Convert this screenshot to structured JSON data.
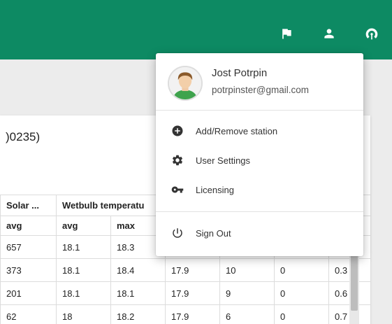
{
  "colors": {
    "topbar": "#0d8a63",
    "menu_bg": "#ffffff"
  },
  "topbar": {
    "icons": [
      "flag-icon",
      "person-icon",
      "wireless-icon"
    ]
  },
  "page": {
    "title": ")0235)"
  },
  "table": {
    "group_headers": [
      "Solar ...",
      "Wetbulb temperatu"
    ],
    "sub_headers": [
      "avg",
      "avg",
      "max"
    ],
    "rows": [
      [
        "657",
        "18.1",
        "18.3",
        "",
        "",
        "",
        ""
      ],
      [
        "373",
        "18.1",
        "18.4",
        "17.9",
        "10",
        "0",
        "0.3"
      ],
      [
        "201",
        "18.1",
        "18.1",
        "17.9",
        "9",
        "0",
        "0.6"
      ],
      [
        "62",
        "18",
        "18.2",
        "17.9",
        "6",
        "0",
        "0.7"
      ]
    ]
  },
  "user_menu": {
    "name": "Jost Potrpin",
    "email": "potrpinster@gmail.com",
    "items": [
      {
        "label": "Add/Remove station",
        "icon": "add-circle-icon"
      },
      {
        "label": "User Settings",
        "icon": "gear-icon"
      },
      {
        "label": "Licensing",
        "icon": "key-icon"
      },
      {
        "label": "Sign Out",
        "icon": "power-icon"
      }
    ]
  }
}
